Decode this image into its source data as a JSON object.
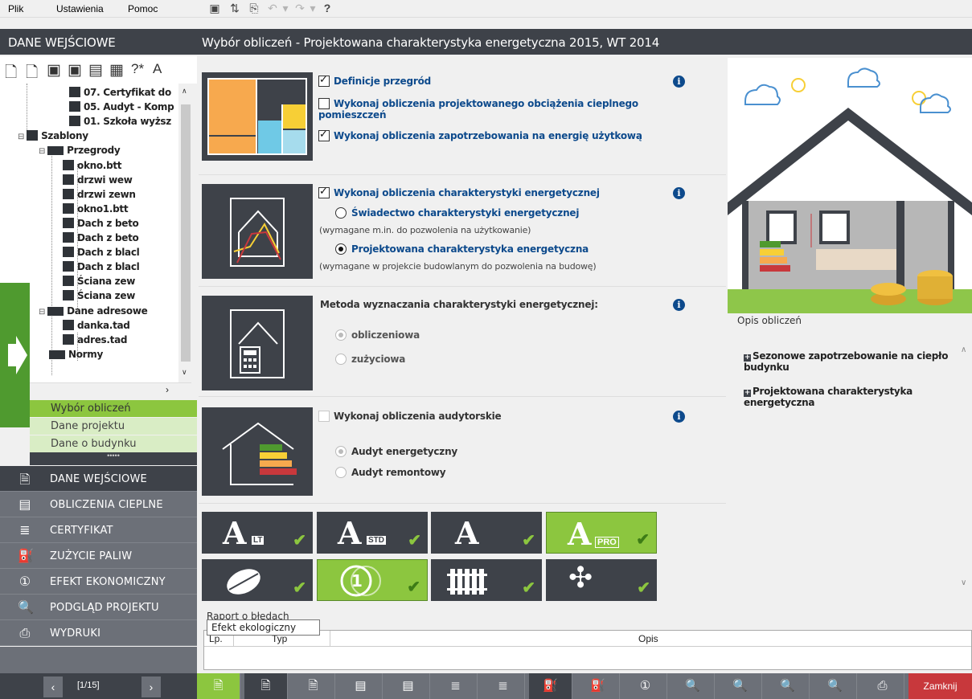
{
  "menu": {
    "file": "Plik",
    "settings": "Ustawienia",
    "help": "Pomoc"
  },
  "toolbar_icons": [
    "save-icon",
    "refresh-icon",
    "preview-icon",
    "undo-icon",
    "undo-dropdown-icon",
    "redo-icon",
    "redo-dropdown-icon",
    "help-icon"
  ],
  "left_panel": {
    "title": "DANE WEJŚCIOWE",
    "tree": [
      {
        "label": "07. Certyfikat do",
        "level": 3,
        "icon": "document-icon"
      },
      {
        "label": "05. Audyt - Komp",
        "level": 3,
        "icon": "document-icon"
      },
      {
        "label": "01. Szkoła wyższ",
        "level": 3,
        "icon": "document-icon"
      },
      {
        "label": "Szablony",
        "level": 0,
        "icon": "templates-icon"
      },
      {
        "label": "Przegrody",
        "level": 1,
        "icon": "folder-icon"
      },
      {
        "label": "okno.btt",
        "level": 2,
        "icon": "partition-icon"
      },
      {
        "label": "drzwi wew",
        "level": 2,
        "icon": "partition-icon"
      },
      {
        "label": "drzwi zewn",
        "level": 2,
        "icon": "partition-icon"
      },
      {
        "label": "okno1.btt",
        "level": 2,
        "icon": "partition-icon"
      },
      {
        "label": "Dach z beto",
        "level": 2,
        "icon": "partition-icon"
      },
      {
        "label": "Dach z beto",
        "level": 2,
        "icon": "partition-icon"
      },
      {
        "label": "Dach z blacl",
        "level": 2,
        "icon": "partition-icon"
      },
      {
        "label": "Dach z blacl",
        "level": 2,
        "icon": "partition-icon"
      },
      {
        "label": "Ściana zew",
        "level": 2,
        "icon": "partition-icon"
      },
      {
        "label": "Ściana zew",
        "level": 2,
        "icon": "partition-icon"
      },
      {
        "label": "Dane adresowe",
        "level": 1,
        "icon": "folder-icon"
      },
      {
        "label": "danka.tad",
        "level": 2,
        "icon": "address-icon"
      },
      {
        "label": "adres.tad",
        "level": 2,
        "icon": "address-icon"
      },
      {
        "label": "Normy",
        "level": 1,
        "icon": "norms-icon"
      }
    ],
    "sub_nav": [
      {
        "label": "Wybór obliczeń",
        "active": true
      },
      {
        "label": "Dane projektu",
        "active": false
      },
      {
        "label": "Dane o budynku",
        "active": false
      }
    ],
    "nav": [
      {
        "label": "DANE WEJŚCIOWE",
        "icon": "input-data-icon",
        "active": true
      },
      {
        "label": "OBLICZENIA CIEPLNE",
        "icon": "calculations-icon",
        "active": false
      },
      {
        "label": "CERTYFIKAT",
        "icon": "certificate-icon",
        "active": false
      },
      {
        "label": "ZUŻYCIE PALIW",
        "icon": "fuel-icon",
        "active": false
      },
      {
        "label": "EFEKT EKONOMICZNY",
        "icon": "economic-icon",
        "active": false
      },
      {
        "label": "PODGLĄD PROJEKTU",
        "icon": "preview-icon",
        "active": false
      },
      {
        "label": "WYDRUKI",
        "icon": "printer-icon",
        "active": false
      }
    ],
    "pager": "[1/15]"
  },
  "main": {
    "title": "Wybór obliczeń - Projektowana charakterystyka energetyczna 2015, WT 2014",
    "section1": {
      "opt1": "Definicje przegród",
      "opt2": "Wykonaj obliczenia projektowanego obciążenia cieplnego pomieszczeń",
      "opt3": "Wykonaj obliczenia zapotrzebowania na energię użytkową"
    },
    "section2": {
      "opt1": "Wykonaj obliczenia charakterystyki energetycznej",
      "radio1": "Świadectwo charakterystyki energetycznej",
      "note1": "(wymagane m.in. do pozwolenia na użytkowanie)",
      "radio2": "Projektowana charakterystyka energetyczna",
      "note2": "(wymagane w projekcie budowlanym do pozwolenia na budowę)"
    },
    "section3": {
      "label": "Metoda wyznaczania charakterystyki energetycznej:",
      "radio1": "obliczeniowa",
      "radio2": "zużyciowa"
    },
    "section4": {
      "opt1": "Wykonaj obliczenia audytorskie",
      "radio1": "Audyt energetyczny",
      "radio2": "Audyt remontowy"
    },
    "modules_row1": [
      {
        "name": "module-arcadia-lt",
        "badge": "LT",
        "active": false
      },
      {
        "name": "module-arcadia-std",
        "badge": "STD",
        "active": false
      },
      {
        "name": "module-arcadia",
        "badge": "",
        "active": false
      },
      {
        "name": "module-arcadia-pro",
        "badge": "PRO",
        "active": true
      }
    ],
    "modules_row2": [
      {
        "name": "module-ecological",
        "active": false
      },
      {
        "name": "module-economic",
        "active": true
      },
      {
        "name": "module-heating",
        "active": false
      },
      {
        "name": "module-ventilation",
        "active": false
      }
    ]
  },
  "right_panel": {
    "heading": "Opis obliczeń",
    "item1": "Sezonowe zapotrzebowanie na ciepło budynku",
    "item2": "Projektowana charakterystyka energetyczna"
  },
  "report": {
    "heading": "Raport o błędach",
    "col_lp": "Lp.",
    "col_typ": "Typ",
    "col_opis": "Opis"
  },
  "tooltip": "Efekt ekologiczny",
  "bottom_bar": {
    "close": "Zamknij"
  },
  "colors": {
    "accent_green": "#8cc63f",
    "dark": "#3e4249",
    "nav": "#6c7078",
    "link_blue": "#0d4a8c",
    "close_red": "#c8383c"
  }
}
